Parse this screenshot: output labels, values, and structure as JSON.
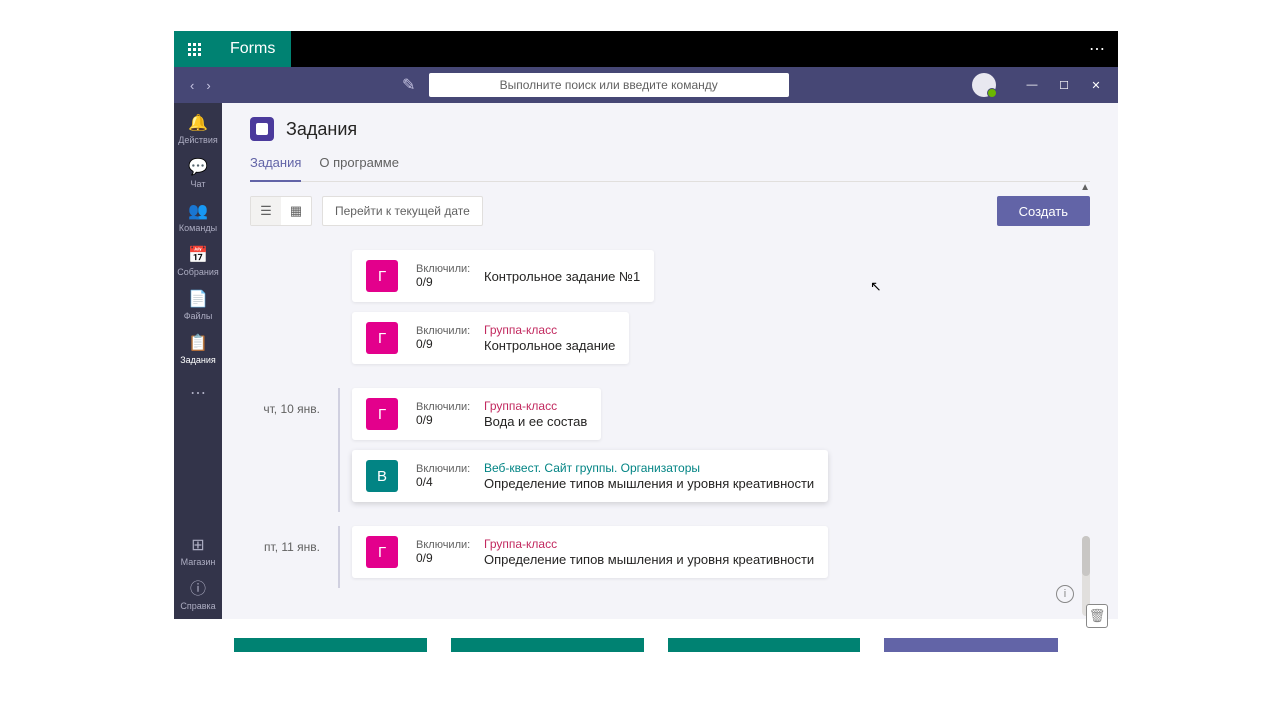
{
  "topbar": {
    "forms_label": "Forms"
  },
  "titlebar": {
    "search_placeholder": "Выполните поиск или введите команду"
  },
  "rail": {
    "items": [
      {
        "icon": "🔔",
        "label": "Действия"
      },
      {
        "icon": "💬",
        "label": "Чат"
      },
      {
        "icon": "👥",
        "label": "Команды"
      },
      {
        "icon": "📅",
        "label": "Собрания"
      },
      {
        "icon": "📄",
        "label": "Файлы"
      },
      {
        "icon": "📋",
        "label": "Задания"
      }
    ],
    "store_label": "Магазин",
    "help_label": "Справка"
  },
  "header": {
    "title": "Задания",
    "tabs": [
      {
        "label": "Задания",
        "active": true
      },
      {
        "label": "О программе",
        "active": false
      }
    ]
  },
  "toolbar": {
    "goto_label": "Перейти к текущей дате",
    "create_label": "Создать"
  },
  "meta_label": "Включили:",
  "days": [
    {
      "date": "",
      "cards": [
        {
          "badge": "Г",
          "badge_color": "pink",
          "count": "0/9",
          "group": "",
          "group_hidden": true,
          "title": "Контрольное задание №1"
        },
        {
          "badge": "Г",
          "badge_color": "pink",
          "count": "0/9",
          "group": "Группа-класс",
          "title": "Контрольное задание"
        }
      ]
    },
    {
      "date": "чт, 10 янв.",
      "cards": [
        {
          "badge": "Г",
          "badge_color": "pink",
          "count": "0/9",
          "group": "Группа-класс",
          "title": "Вода и ее состав"
        },
        {
          "badge": "В",
          "badge_color": "teal",
          "count": "0/4",
          "group": "Веб-квест. Сайт группы. Организаторы",
          "group_teal": true,
          "title": "Определение типов мышления и уровня креативности",
          "selected": true
        }
      ]
    },
    {
      "date": "пт, 11 янв.",
      "cards": [
        {
          "badge": "Г",
          "badge_color": "pink",
          "count": "0/9",
          "group": "Группа-класс",
          "title": "Определение типов мышления и уровня креативности"
        }
      ]
    }
  ]
}
